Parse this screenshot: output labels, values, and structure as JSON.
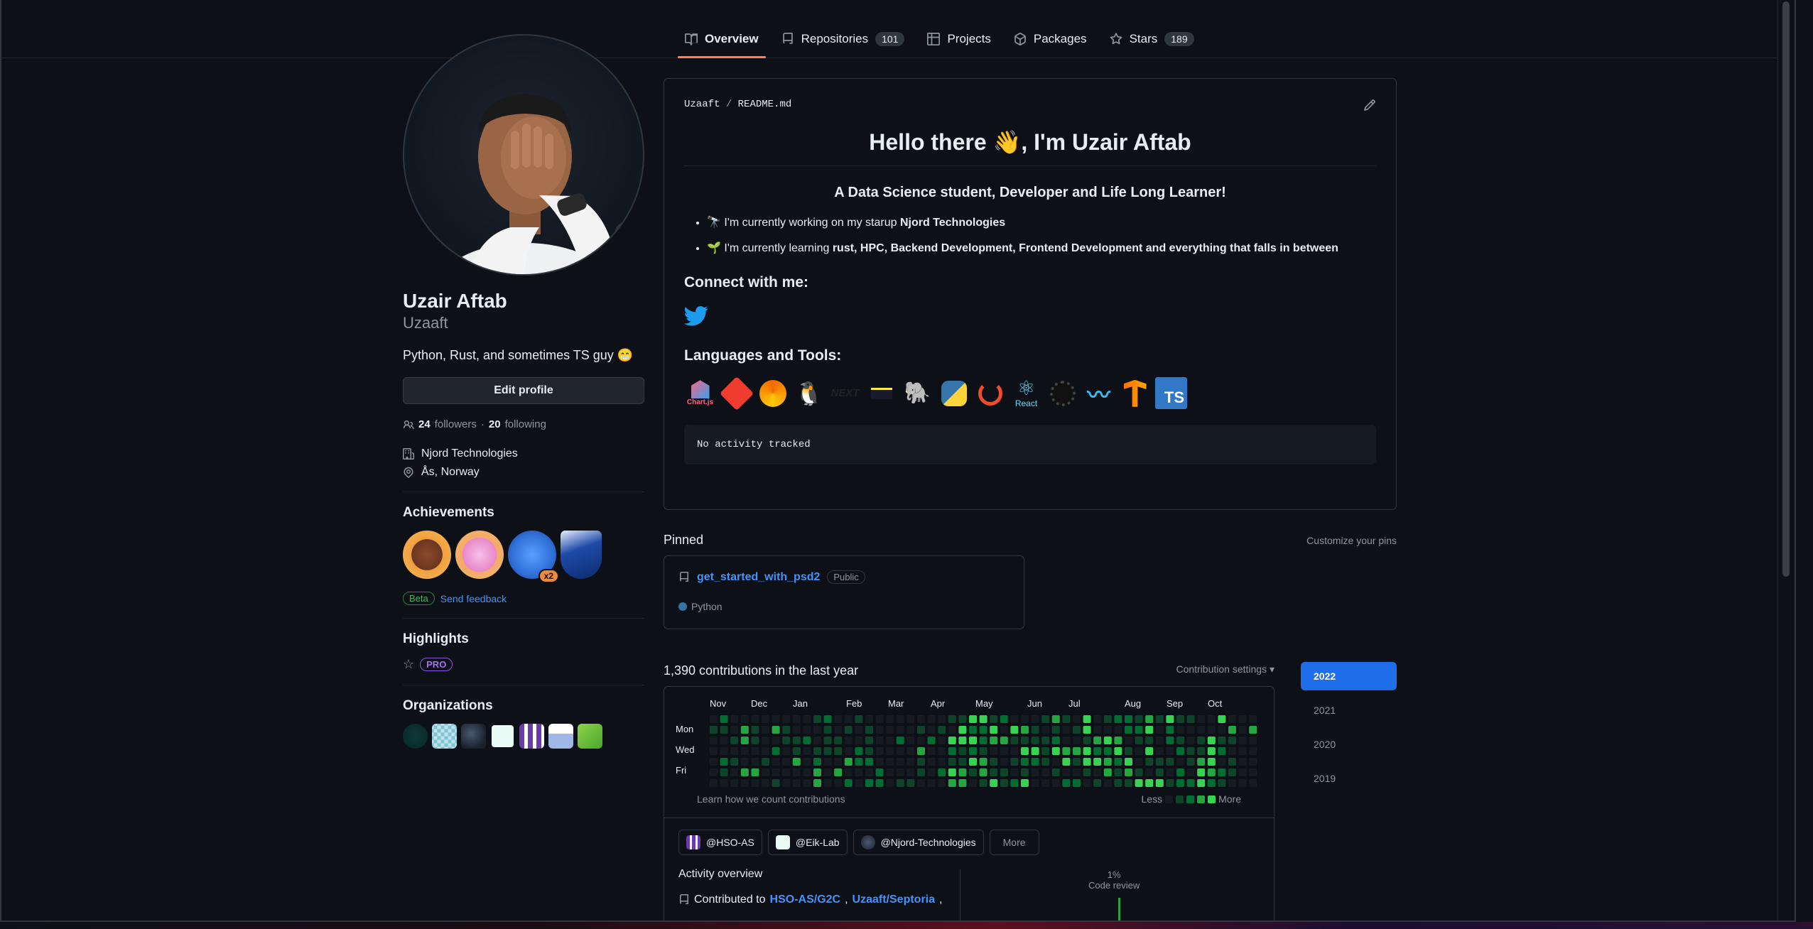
{
  "tabs": [
    {
      "label": "Overview",
      "count": ""
    },
    {
      "label": "Repositories",
      "count": "101"
    },
    {
      "label": "Projects",
      "count": ""
    },
    {
      "label": "Packages",
      "count": ""
    },
    {
      "label": "Stars",
      "count": "189"
    }
  ],
  "profile": {
    "full_name": "Uzair Aftab",
    "username": "Uzaaft",
    "bio": "Python, Rust, and sometimes TS guy 😁",
    "edit_label": "Edit profile",
    "followers_count": "24",
    "followers_label": "followers",
    "separator": "·",
    "following_count": "20",
    "following_label": "following",
    "company": "Njord Technologies",
    "location": "Ås, Norway"
  },
  "achievements": {
    "title": "Achievements",
    "badge_multiplier": "x2",
    "beta_label": "Beta",
    "feedback_label": "Send feedback"
  },
  "highlights": {
    "title": "Highlights",
    "pro_label": "PRO"
  },
  "organizations": {
    "title": "Organizations"
  },
  "readme": {
    "owner": "Uzaaft",
    "sep": "/",
    "file": "README.md",
    "heading": "Hello there 👋, I'm Uzair Aftab",
    "subheading": "A Data Science student, Developer and Life Long Learner!",
    "item1_prefix": "🔭 I'm currently working on my starup ",
    "item1_bold": "Njord Technologies",
    "item2_prefix": "🌱 I'm currently learning ",
    "item2_bold": "rust, HPC, Backend Development, Frontend Development and everything that falls in between",
    "connect_title": "Connect with me:",
    "tools_title": "Languages and Tools:",
    "tools": [
      "Chart.js",
      "git",
      "grafana",
      "linux",
      "NEXT",
      "nim",
      "postgresql",
      "python",
      "pytorch",
      "React",
      "rust",
      "tailwind",
      "tensorflow",
      "TS"
    ],
    "react_label": "React",
    "chartjs_label": "Chart.js",
    "next_label": "NEXT",
    "ts_label": "TS",
    "no_activity": "No activity tracked"
  },
  "pinned": {
    "title": "Pinned",
    "customize": "Customize your pins",
    "repo_name": "get_started_with_psd2",
    "visibility": "Public",
    "language": "Python",
    "language_color": "#3572a5"
  },
  "contributions": {
    "title": "1,390 contributions in the last year",
    "settings": "Contribution settings ▾",
    "months": [
      "Nov",
      "Dec",
      "Jan",
      "Feb",
      "Mar",
      "Apr",
      "May",
      "Jun",
      "Jul",
      "Aug",
      "Sep",
      "Oct"
    ],
    "days": [
      "Mon",
      "Wed",
      "Fri"
    ],
    "learn_text": "Learn how we count contributions",
    "less": "Less",
    "more": "More",
    "colors": [
      "#161b22",
      "#0e4429",
      "#006d32",
      "#26a641",
      "#39d353"
    ]
  },
  "years": [
    "2022",
    "2021",
    "2020",
    "2019"
  ],
  "activity": {
    "chips": [
      "@HSO-AS",
      "@Eik-Lab",
      "@Njord-Technologies"
    ],
    "more_label": "More",
    "overview_title": "Activity overview",
    "contributed_to": "Contributed to",
    "repo1": "HSO-AS/G2C",
    "repo2": "Uzaaft/Septoria",
    "comma": ",",
    "percent": "1%",
    "code_review": "Code review"
  }
}
